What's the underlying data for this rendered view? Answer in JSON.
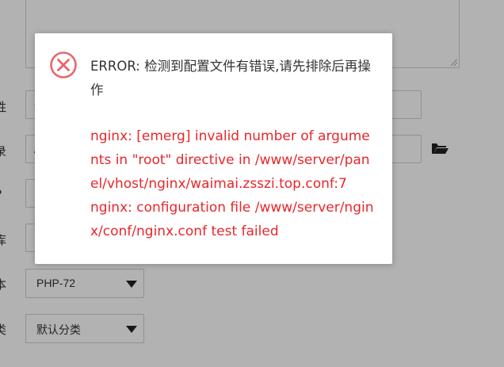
{
  "background_form": {
    "labels": [
      "姓",
      "录",
      "P",
      "库",
      "本",
      "类"
    ],
    "php_version": "PHP-72",
    "category": "默认分类",
    "input_fragments": [
      "一",
      "/"
    ]
  },
  "dialog": {
    "icon": "error-circle-x-icon",
    "title": "ERROR: 检测到配置文件有错误,请先排除后再操作",
    "detail_lines": [
      "nginx: [emerg] invalid number of arguments in \"root\" directive in /www/server/panel/vhost/nginx/waimai.zsszi.top.conf:7",
      "nginx: configuration file /www/server/nginx/conf/nginx.conf test failed"
    ],
    "colors": {
      "error": "#e8262b",
      "icon": "#e8676b",
      "text": "#333333"
    }
  }
}
